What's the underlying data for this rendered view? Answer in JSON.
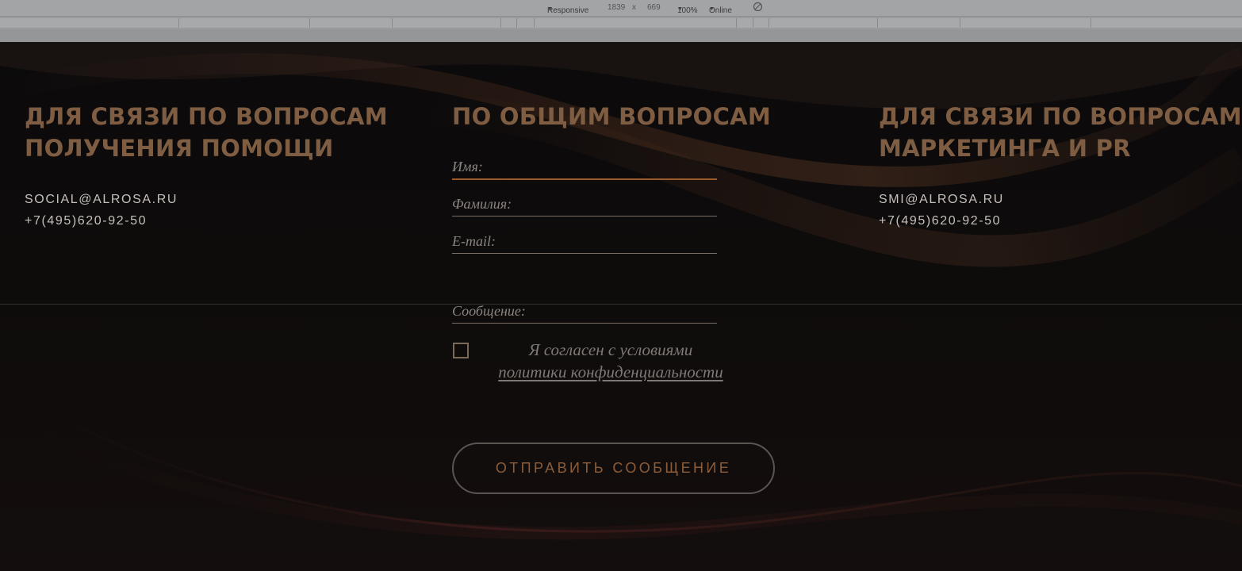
{
  "devtools": {
    "device": "Responsive",
    "width": "1839",
    "times": "x",
    "height": "669",
    "zoom": "100%",
    "network": "Online"
  },
  "colors": {
    "accent": "#7e5d42",
    "button_text": "#8b5d3a",
    "background": "#0c0a0a"
  },
  "help": {
    "title": "ДЛЯ СВЯЗИ ПО ВОПРОСАМ\nПОЛУЧЕНИЯ ПОМОЩИ",
    "email": "SOCIAL@ALROSA.RU",
    "phone": "+7(495)620-92-50"
  },
  "general": {
    "title": "ПО ОБЩИМ ВОПРОСАМ",
    "fields": {
      "name": "Имя:",
      "surname": "Фамилия:",
      "email": "E-mail:",
      "message": "Сообщение:"
    },
    "consent_text": "Я согласен с условиями",
    "consent_link": "политики конфиденциальности",
    "submit": "ОТПРАВИТЬ СООБЩЕНИЕ"
  },
  "marketing": {
    "title": "ДЛЯ СВЯЗИ ПО ВОПРОСАМ\nМАРКЕТИНГА И PR",
    "email": "SMI@ALROSA.RU",
    "phone": "+7(495)620-92-50"
  }
}
